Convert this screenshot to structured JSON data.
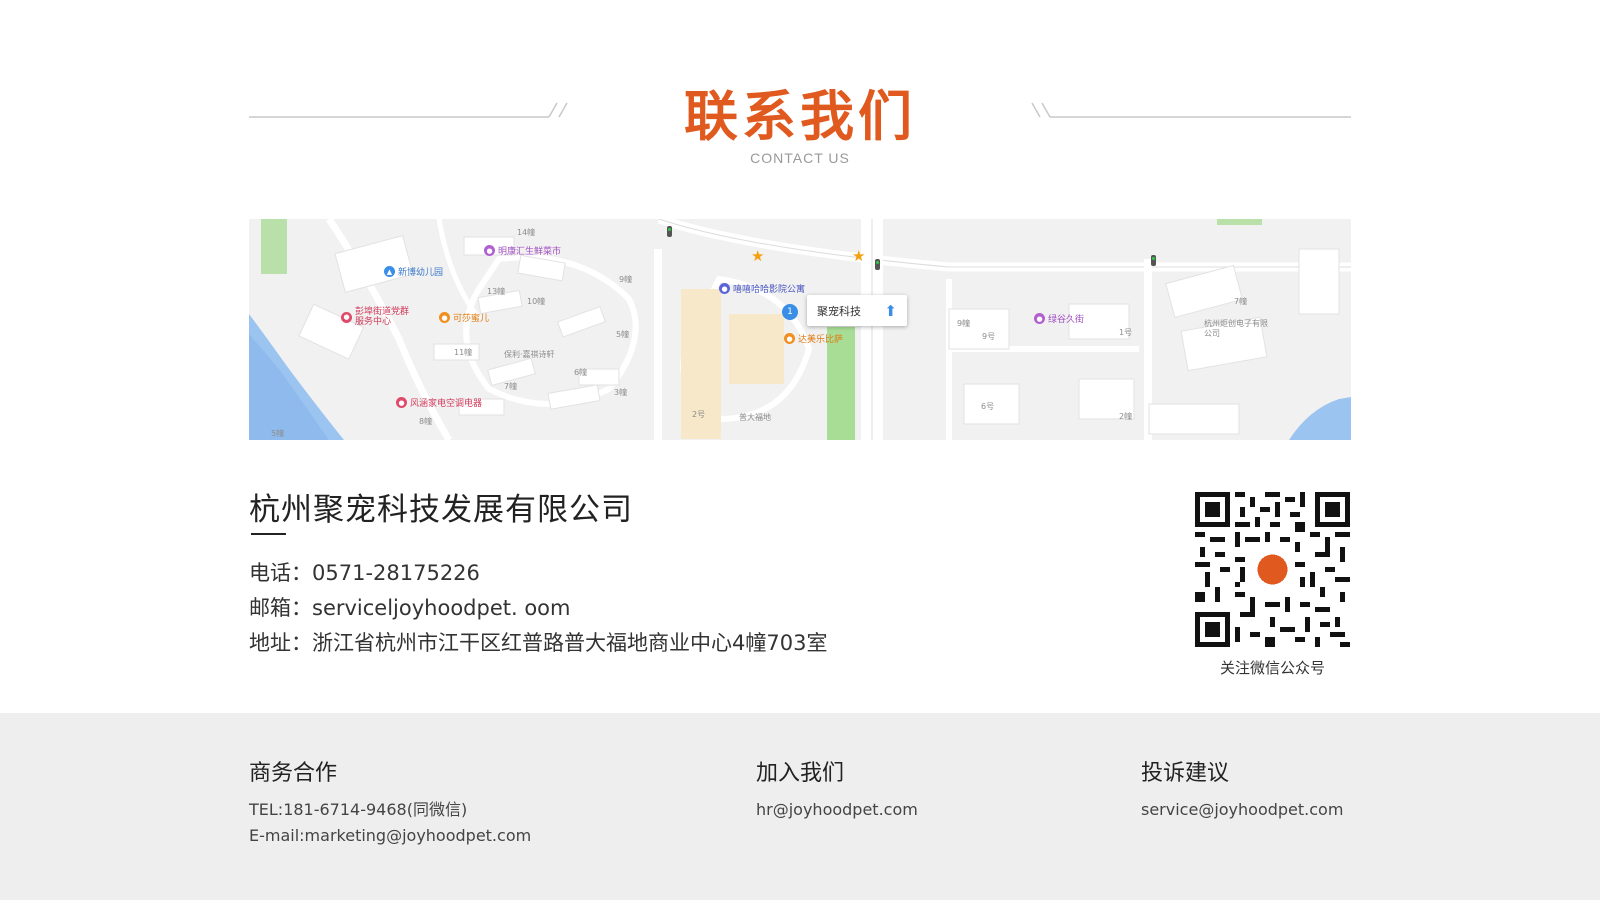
{
  "header": {
    "title": "联系我们",
    "subtitle": "CONTACT US"
  },
  "map": {
    "marker_label": "聚宠科技",
    "marker_number": "1",
    "pois": [
      "明康汇生鲜菜市",
      "新博幼儿园",
      "彭埠街道党群服务中心",
      "可莎蜜儿",
      "嘻嘻哈哈影院公寓",
      "达美乐比萨",
      "绿谷久街",
      "风涵家电空调电器"
    ],
    "building_labels": [
      "14幢",
      "13幢",
      "10幢",
      "9幢",
      "5幢",
      "11幢",
      "6幢",
      "7幢",
      "3幢",
      "8幢",
      "5幢",
      "2号",
      "保利·嘉祺诗轩",
      "普大福地",
      "9幢",
      "9号",
      "1号",
      "6号",
      "2幢",
      "7幢",
      "杭州炬创电子有限公司"
    ]
  },
  "company": {
    "name": "杭州聚宠科技发展有限公司",
    "phone_label": "电话：",
    "phone": "0571-28175226",
    "email_label": "邮箱：",
    "email": "serviceljoyhoodpet. oom",
    "address_label": "地址：",
    "address": "浙江省杭州市江干区红普路普大福地商业中心4幢703室"
  },
  "qr": {
    "caption": "关注微信公众号"
  },
  "footer": {
    "business": {
      "heading": "商务合作",
      "tel": "TEL:181-6714-9468(同微信)",
      "email": "E-mail:marketing@joyhoodpet.com"
    },
    "join": {
      "heading": "加入我们",
      "email": "hr@joyhoodpet.com"
    },
    "complaint": {
      "heading": "投诉建议",
      "email": "service@joyhoodpet.com"
    }
  },
  "colors": {
    "accent": "#e05a1f",
    "footer_bg": "#eeeeee"
  }
}
